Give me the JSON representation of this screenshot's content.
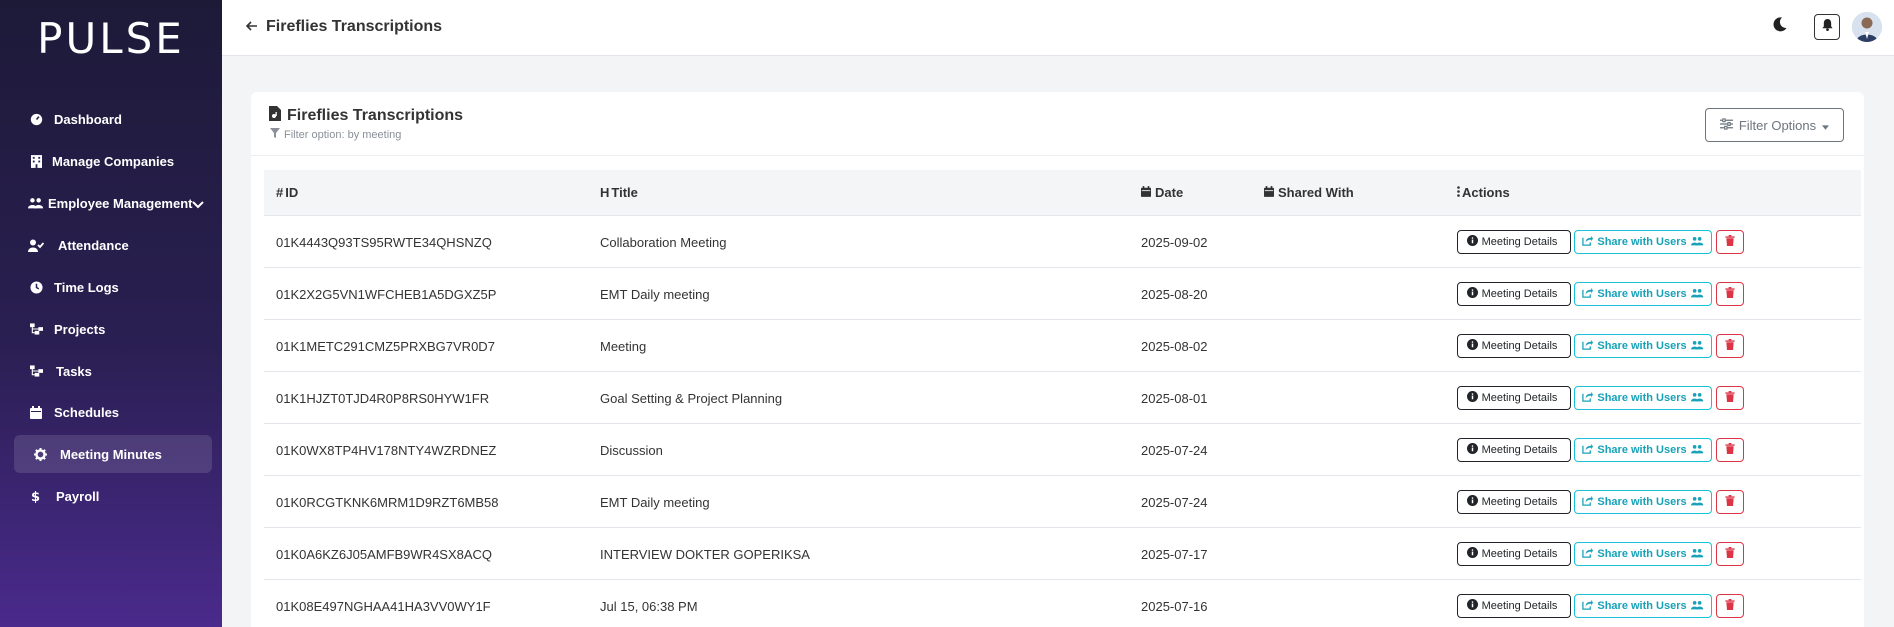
{
  "app": {
    "logo": "PULSE"
  },
  "sidebar": {
    "items": [
      {
        "label": "Dashboard",
        "icon": "dashboard-gauge-icon"
      },
      {
        "label": "Manage Companies",
        "icon": "building-icon"
      },
      {
        "label": "Employee Management",
        "icon": "users-icon"
      },
      {
        "label": "Attendance",
        "icon": "user-check-icon"
      },
      {
        "label": "Time Logs",
        "icon": "clock-icon"
      },
      {
        "label": "Projects",
        "icon": "sitemap-icon"
      },
      {
        "label": "Tasks",
        "icon": "sitemap-icon"
      },
      {
        "label": "Schedules",
        "icon": "calendar-icon"
      },
      {
        "label": "Meeting Minutes",
        "icon": "gear-icon",
        "active": true
      },
      {
        "label": "Payroll",
        "icon": "dollar-icon"
      }
    ]
  },
  "topbar": {
    "title": "Fireflies Transcriptions"
  },
  "card": {
    "title": "Fireflies Transcriptions",
    "subtitle": "Filter option: by meeting",
    "filter_button": "Filter Options"
  },
  "table": {
    "headers": {
      "id": "ID",
      "title": "Title",
      "date": "Date",
      "shared": "Shared With",
      "actions": "Actions"
    },
    "actions": {
      "details": "Meeting Details",
      "share": "Share with Users"
    },
    "rows": [
      {
        "id": "01K4443Q93TS95RWTE34QHSNZQ",
        "title": "Collaboration Meeting",
        "date": "2025-09-02",
        "shared": ""
      },
      {
        "id": "01K2X2G5VN1WFCHEB1A5DGXZ5P",
        "title": "EMT Daily meeting",
        "date": "2025-08-20",
        "shared": ""
      },
      {
        "id": "01K1METC291CMZ5PRXBG7VR0D7",
        "title": "Meeting",
        "date": "2025-08-02",
        "shared": ""
      },
      {
        "id": "01K1HJZT0TJD4R0P8RS0HYW1FR",
        "title": "Goal Setting & Project Planning",
        "date": "2025-08-01",
        "shared": ""
      },
      {
        "id": "01K0WX8TP4HV178NTY4WZRDNEZ",
        "title": "Discussion",
        "date": "2025-07-24",
        "shared": ""
      },
      {
        "id": "01K0RCGTKNK6MRM1D9RZT6MB58",
        "title": "EMT Daily meeting",
        "date": "2025-07-24",
        "shared": ""
      },
      {
        "id": "01K0A6KZ6J05AMFB9WR4SX8ACQ",
        "title": "INTERVIEW DOKTER GOPERIKSA",
        "date": "2025-07-17",
        "shared": ""
      },
      {
        "id": "01K08E497NGHAA41HA3VV0WY1F",
        "title": "Jul 15, 06:38 PM",
        "date": "2025-07-16",
        "shared": ""
      }
    ]
  },
  "colors": {
    "accent_cyan": "#17a2b8",
    "danger": "#dc3545",
    "sidebar_top": "#1d1a38",
    "sidebar_bottom": "#4a2a8c"
  }
}
